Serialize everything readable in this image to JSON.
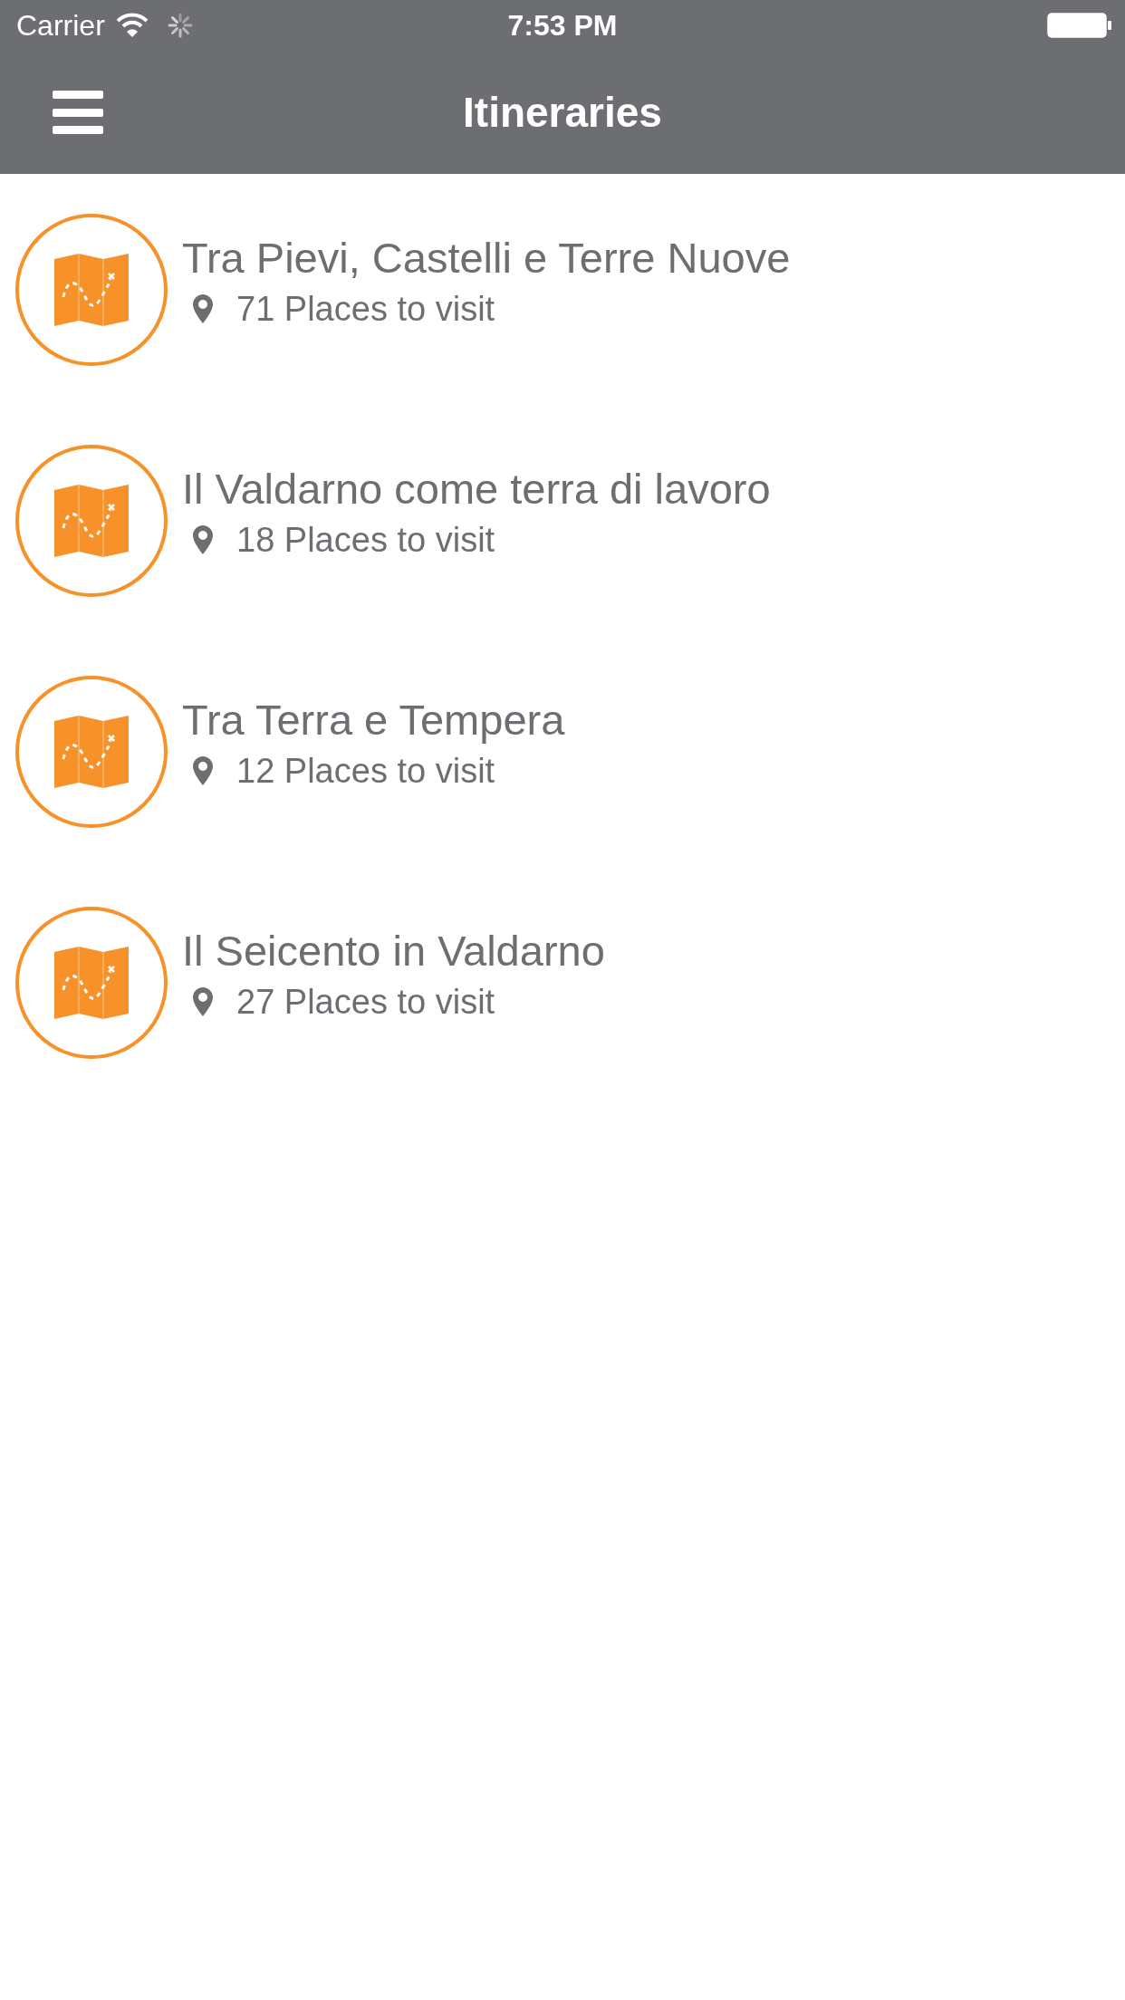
{
  "status_bar": {
    "carrier": "Carrier",
    "time": "7:53 PM"
  },
  "nav_bar": {
    "title": "Itineraries"
  },
  "itineraries": [
    {
      "title": "Tra Pievi, Castelli e Terre Nuove",
      "places": "71 Places to visit"
    },
    {
      "title": "Il Valdarno come terra di lavoro",
      "places": "18 Places to visit"
    },
    {
      "title": "Tra Terra e Tempera",
      "places": "12 Places to visit"
    },
    {
      "title": "Il Seicento in Valdarno",
      "places": "27 Places to visit"
    }
  ]
}
